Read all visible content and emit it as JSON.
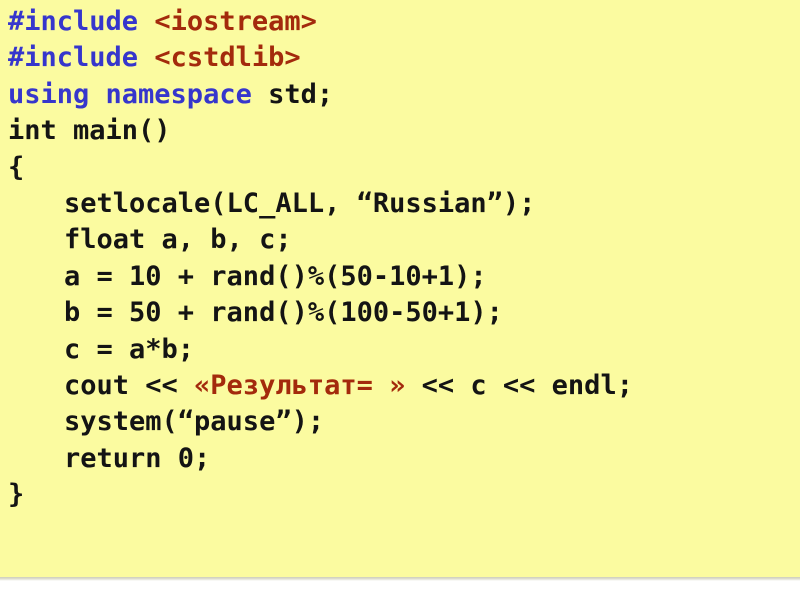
{
  "panel": {
    "background_color": "#fbfba0",
    "language": "C++",
    "shadow_color": "#cfcfbc"
  },
  "colors": {
    "keyword_blue": "#3636cc",
    "string_red": "#a32a0c",
    "plain_black": "#141414"
  },
  "code": {
    "full_text": "#include <iostream>\n#include <cstdlib>\nusing namespace std;\nint main()\n{\n    setlocale(LC_ALL, “Russian”);\n    float a, b, c;\n    a = 10 + rand()%(50-10+1);\n    b = 50 + rand()%(100-50+1);\n    c = a*b;\n    cout << «Результат= » << c << endl;\n    system(“pause”);\n    return 0;\n}",
    "lines": [
      {
        "indent": false,
        "tokens": [
          {
            "text": "#include ",
            "color": "blue"
          },
          {
            "text": "<iostream>",
            "color": "red"
          }
        ]
      },
      {
        "indent": false,
        "tokens": [
          {
            "text": "#include ",
            "color": "blue"
          },
          {
            "text": "<cstdlib>",
            "color": "red"
          }
        ]
      },
      {
        "indent": false,
        "tokens": [
          {
            "text": "using namespace ",
            "color": "blue"
          },
          {
            "text": "std;",
            "color": "black"
          }
        ]
      },
      {
        "indent": false,
        "tokens": [
          {
            "text": "int main()",
            "color": "black"
          }
        ]
      },
      {
        "indent": false,
        "tokens": [
          {
            "text": "{",
            "color": "black"
          }
        ]
      },
      {
        "indent": true,
        "tokens": [
          {
            "text": "setlocale(LC_ALL, “Russian”);",
            "color": "black"
          }
        ]
      },
      {
        "indent": true,
        "tokens": [
          {
            "text": "float a, b, c;",
            "color": "black"
          }
        ]
      },
      {
        "indent": true,
        "tokens": [
          {
            "text": "a = 10 + rand()%(50-10+1);",
            "color": "black"
          }
        ]
      },
      {
        "indent": true,
        "tokens": [
          {
            "text": "b = 50 + rand()%(100-50+1);",
            "color": "black"
          }
        ]
      },
      {
        "indent": true,
        "tokens": [
          {
            "text": "c = a*b;",
            "color": "black"
          }
        ]
      },
      {
        "indent": true,
        "tokens": [
          {
            "text": "cout << ",
            "color": "black"
          },
          {
            "text": "«Результат= »",
            "color": "red"
          },
          {
            "text": " << c << endl;",
            "color": "black"
          }
        ]
      },
      {
        "indent": true,
        "tokens": [
          {
            "text": "system(“pause”);",
            "color": "black"
          }
        ]
      },
      {
        "indent": true,
        "tokens": [
          {
            "text": "return 0;",
            "color": "black"
          }
        ]
      },
      {
        "indent": false,
        "tokens": [
          {
            "text": "}",
            "color": "black"
          }
        ]
      }
    ]
  }
}
